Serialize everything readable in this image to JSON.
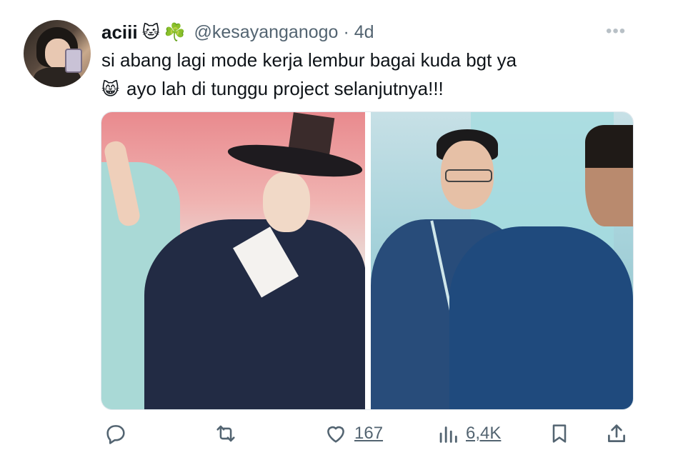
{
  "author": {
    "name": "aciii",
    "emojis": [
      "🐱",
      "☘️"
    ],
    "handle": "@kesayanganogo",
    "separator": "·",
    "time": "4d"
  },
  "more_icon": "•••",
  "tweet": {
    "line1": "si abang lagi mode kerja lembur bagai kuda bgt ya",
    "line2_emoji": "😸",
    "line2_text": "ayo lah di tunggu project selanjutnya!!!"
  },
  "actions": {
    "reply": {
      "icon": "reply-icon"
    },
    "retweet": {
      "icon": "retweet-icon"
    },
    "like": {
      "icon": "heart-icon",
      "count": "167"
    },
    "views": {
      "icon": "views-icon",
      "count": "6,4K"
    },
    "bookmark": {
      "icon": "bookmark-icon"
    },
    "share": {
      "icon": "share-icon"
    }
  },
  "colors": {
    "text": "#0f1419",
    "secondary": "#536471"
  }
}
